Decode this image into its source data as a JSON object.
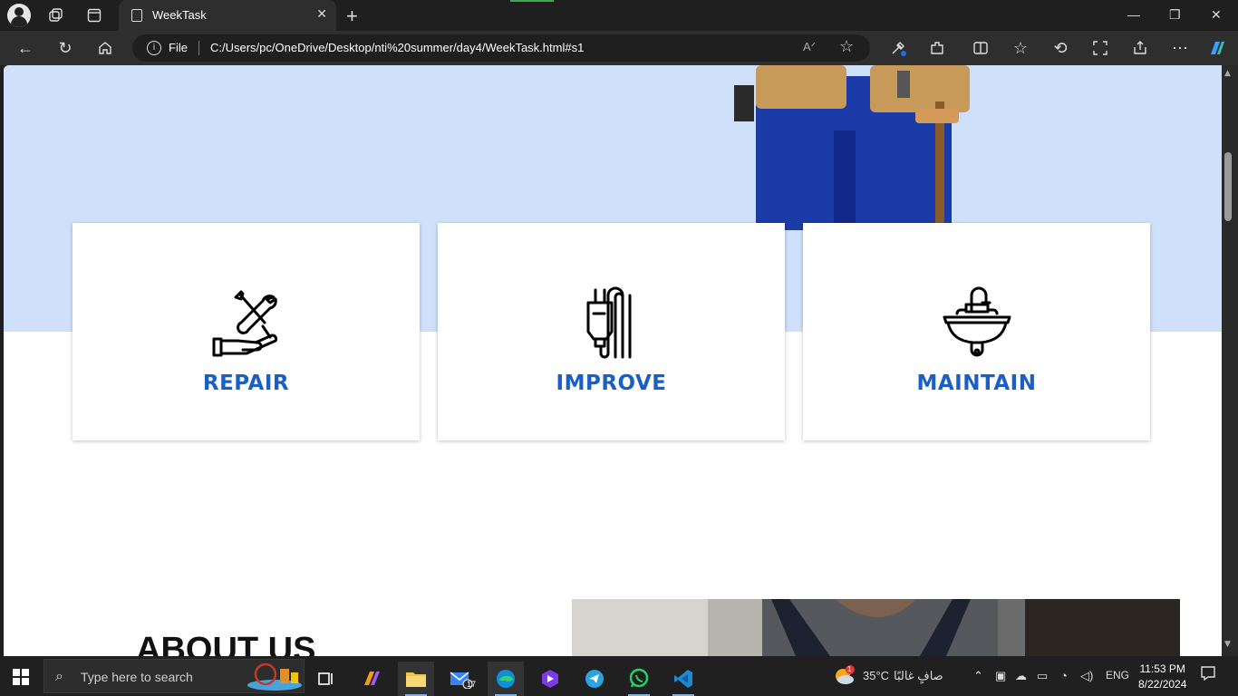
{
  "browser": {
    "tab_title": "WeekTask",
    "new_tab_symbol": "+",
    "close_symbol": "✕",
    "address": {
      "scheme_label": "File",
      "url": "C:/Users/pc/OneDrive/Desktop/nti%20summer/day4/WeekTask.html#s1"
    }
  },
  "page": {
    "services": [
      {
        "label": "REPAIR",
        "icon": "repair-tools-icon"
      },
      {
        "label": "IMPROVE",
        "icon": "plug-icon"
      },
      {
        "label": "MAINTAIN",
        "icon": "sink-icon"
      }
    ],
    "about_title": "ABOUT US",
    "colors": {
      "hero_background": "#cfe0fa",
      "accent": "#1a5fc7"
    }
  },
  "taskbar": {
    "search_placeholder": "Type here to search",
    "mail_badge": "17",
    "weather_badge": "1",
    "temperature": "35°C",
    "weather_text": "صافٍ غالبًا",
    "language": "ENG",
    "time": "11:53 PM",
    "date": "8/22/2024"
  }
}
